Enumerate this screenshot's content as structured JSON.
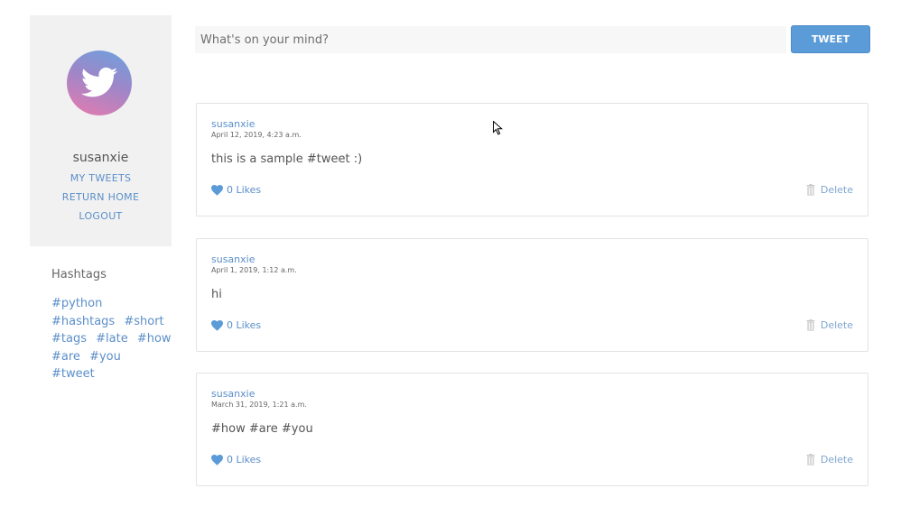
{
  "profile": {
    "username": "susanxie",
    "links": {
      "my_tweets": "MY TWEETS",
      "return_home": "RETURN HOME",
      "logout": "LOGOUT"
    }
  },
  "hashtags": {
    "title": "Hashtags",
    "tags": [
      "#python",
      "#hashtags",
      "#short",
      "#tags",
      "#late",
      "#how",
      "#are",
      "#you",
      "#tweet"
    ]
  },
  "composer": {
    "placeholder": "What's on your mind?",
    "value": "",
    "button_label": "TWEET"
  },
  "tweets": [
    {
      "author": "susanxie",
      "date": "April 12, 2019, 4:23 a.m.",
      "text": "this is a sample #tweet :)",
      "likes": "0 Likes",
      "delete_label": "Delete"
    },
    {
      "author": "susanxie",
      "date": "April 1, 2019, 1:12 a.m.",
      "text": "hi",
      "likes": "0 Likes",
      "delete_label": "Delete"
    },
    {
      "author": "susanxie",
      "date": "March 31, 2019, 1:21 a.m.",
      "text": "#how #are #you",
      "likes": "0 Likes",
      "delete_label": "Delete"
    }
  ],
  "colors": {
    "accent": "#5b9bd8",
    "link": "#5b8fc9",
    "card_background": "#f1f1f1",
    "avatar_gradient": [
      "#6aa3df",
      "#e87aae"
    ]
  },
  "icons": {
    "avatar": "bird-icon",
    "like": "heart-icon",
    "delete": "trash-icon"
  }
}
